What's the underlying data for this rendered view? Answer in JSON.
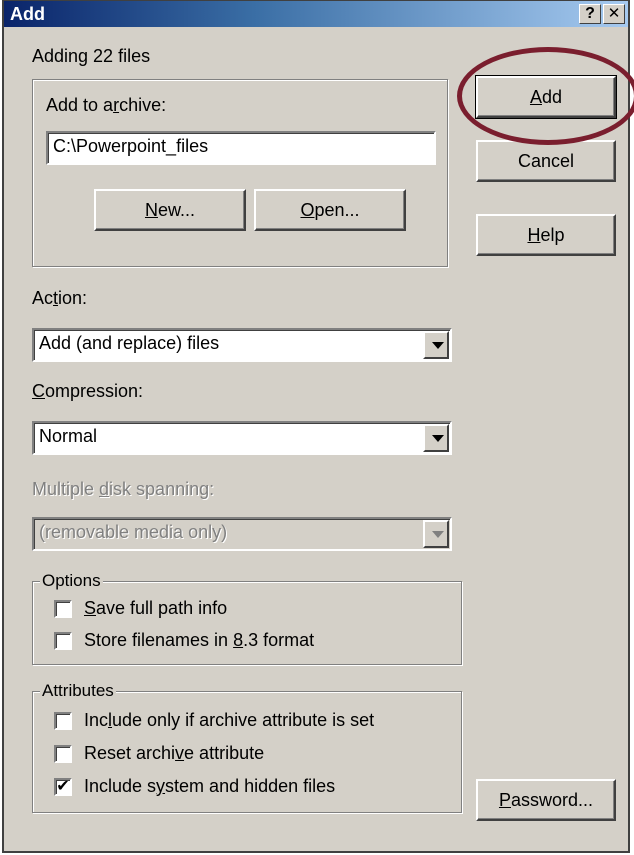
{
  "window": {
    "title": "Add",
    "help_btn": "?",
    "close_btn": "✕"
  },
  "status": {
    "adding_text": "Adding 22 files"
  },
  "archive_group": {
    "label_pre": "Add to a",
    "label_u": "r",
    "label_post": "chive:",
    "path_value": "C:\\Powerpoint_files",
    "new_u": "N",
    "new_rest": "ew...",
    "open_u": "O",
    "open_rest": "pen..."
  },
  "side_buttons": {
    "add_u": "A",
    "add_rest": "dd",
    "cancel": "Cancel",
    "help_u": "H",
    "help_rest": "elp",
    "password_u": "P",
    "password_rest": "assword..."
  },
  "action": {
    "label_pre": "Ac",
    "label_u": "t",
    "label_post": "ion:",
    "selected": "Add (and replace) files"
  },
  "compression": {
    "label_u": "C",
    "label_post": "ompression:",
    "selected": "Normal"
  },
  "spanning": {
    "label_pre": "Multiple ",
    "label_u": "d",
    "label_post": "isk spanning:",
    "selected": "(removable media only)",
    "disabled": true
  },
  "options": {
    "legend": "Options",
    "items": [
      {
        "pre": "",
        "u": "S",
        "post": "ave full path info",
        "checked": false
      },
      {
        "pre": "Store filenames in ",
        "u": "8",
        "post": ".3 format",
        "checked": false
      }
    ]
  },
  "attributes": {
    "legend": "Attributes",
    "items": [
      {
        "pre": "Inc",
        "u": "l",
        "post": "ude only if archive attribute is set",
        "checked": false
      },
      {
        "pre": "Reset archi",
        "u": "v",
        "post": "e attribute",
        "checked": false
      },
      {
        "pre": "Include s",
        "u": "y",
        "post": "stem and hidden files",
        "checked": true
      }
    ]
  },
  "colors": {
    "titlebar_start": "#0a246a",
    "face": "#d4d0c8",
    "highlight_ring": "#7a1e2e"
  }
}
